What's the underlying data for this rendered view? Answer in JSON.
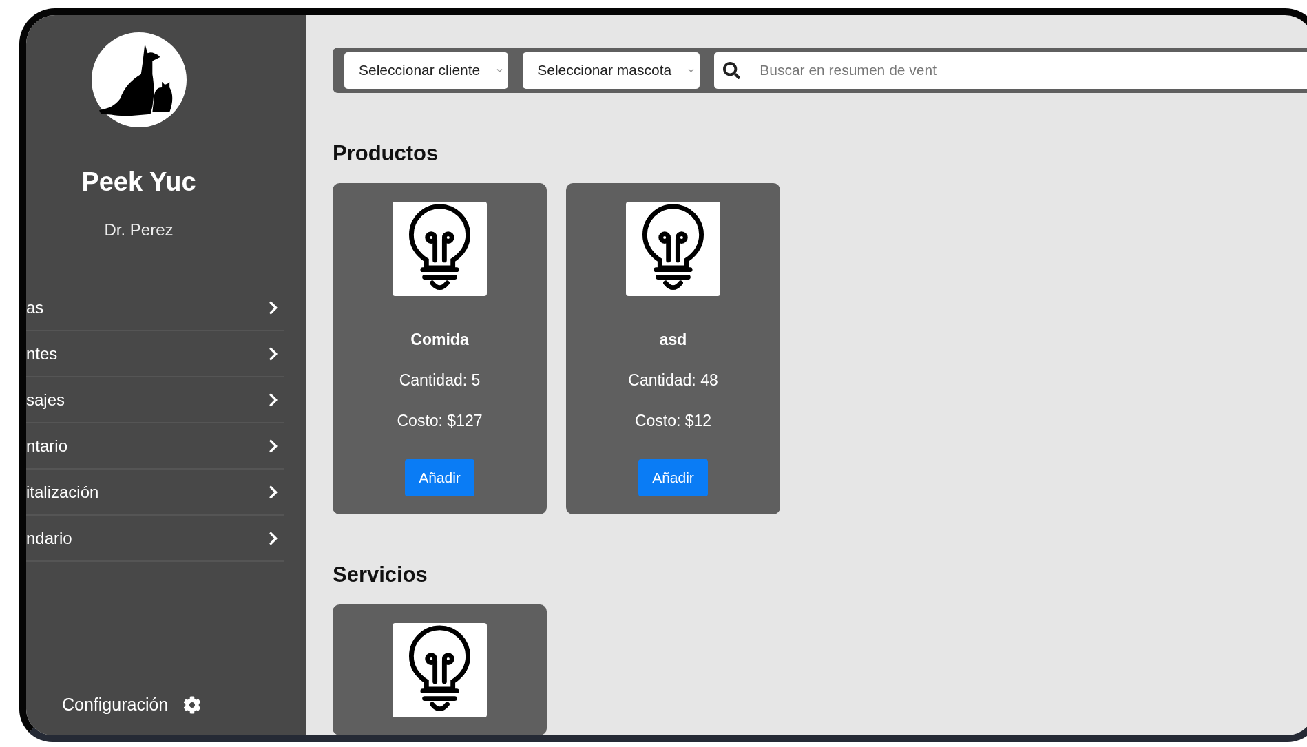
{
  "sidebar": {
    "brand": "Peek Yuc",
    "user": "Dr. Perez",
    "nav_items": [
      {
        "label": "as"
      },
      {
        "label": "ntes"
      },
      {
        "label": "sajes"
      },
      {
        "label": "ntario"
      },
      {
        "label": "italización"
      },
      {
        "label": "ndario"
      }
    ],
    "settings_label": "Configuración"
  },
  "toolbar": {
    "selects": [
      "Seleccionar cliente",
      "Seleccionar mascota"
    ],
    "search": {
      "placeholder": "Buscar en resumen de vent"
    }
  },
  "sections": [
    {
      "title": "Productos",
      "items": [
        {
          "kind": "product",
          "name": "Comida",
          "quantity": "Cantidad: 5",
          "cost": "Costo: $127",
          "button": "Añadir"
        },
        {
          "kind": "product",
          "name": "asd",
          "quantity": "Cantidad: 48",
          "cost": "Costo: $12",
          "button": "Añadir"
        }
      ]
    },
    {
      "title": "Servicios",
      "items": [
        {
          "kind": "image_only"
        }
      ]
    }
  ]
}
